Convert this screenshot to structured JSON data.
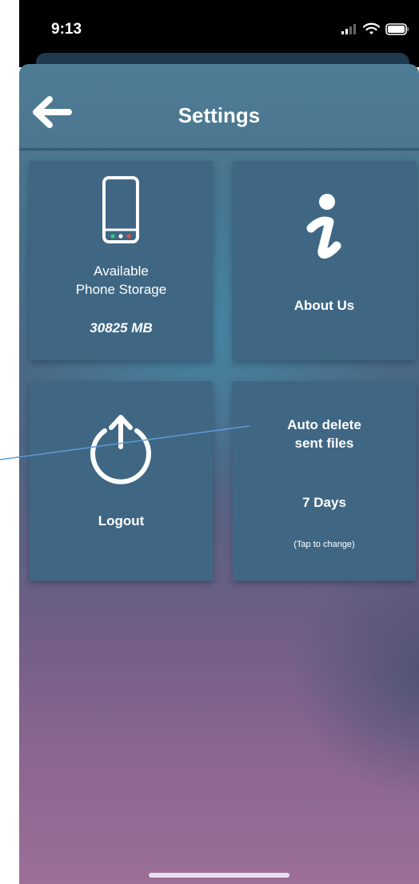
{
  "status_bar": {
    "time": "9:13"
  },
  "header": {
    "title": "Settings"
  },
  "tiles": {
    "storage": {
      "label_line1": "Available",
      "label_line2": "Phone Storage",
      "value": "30825 MB"
    },
    "about": {
      "label": "About Us"
    },
    "logout": {
      "label": "Logout"
    },
    "auto_delete": {
      "label_line1": "Auto delete",
      "label_line2": "sent files",
      "value": "7 Days",
      "hint": "(Tap to change)"
    }
  },
  "icons": {
    "back": "arrow-left-icon",
    "storage": "smartphone-icon",
    "about": "info-icon",
    "logout": "power-icon"
  },
  "colors": {
    "tile": "#3f6784",
    "text": "#ffffff",
    "annotation_line": "#5b9bd5",
    "phone_dot_green": "#2ecc71",
    "phone_dot_red": "#e74c3c"
  }
}
